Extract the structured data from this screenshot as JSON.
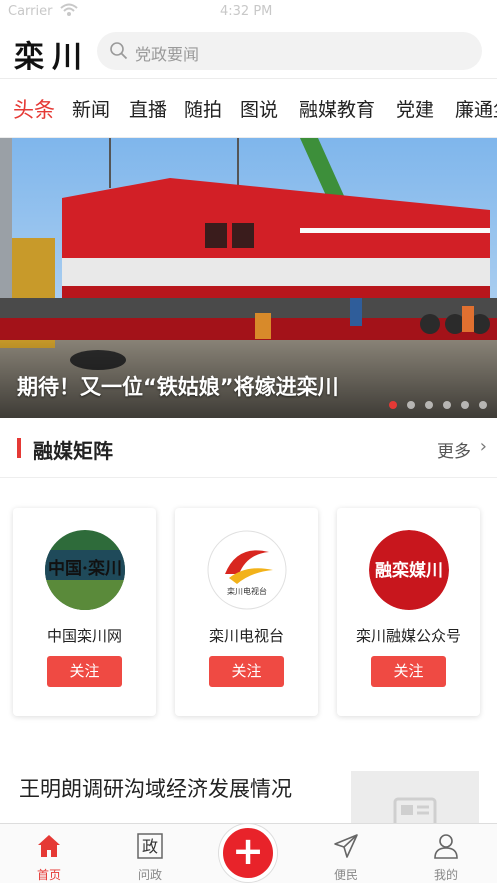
{
  "status_bar": {
    "carrier": "Carrier",
    "time": "4:32 PM"
  },
  "header": {
    "logo": "栾川",
    "search_placeholder": "党政要闻"
  },
  "tabs": [
    "头条",
    "新闻",
    "直播",
    "随拍",
    "图说",
    "融媒教育",
    "党建",
    "廉通尘"
  ],
  "active_tab": 0,
  "banner": {
    "caption": "期待！又一位“铁姑娘”将嫁进栾川",
    "dot_count": 6,
    "active_dot": 0
  },
  "matrix": {
    "title": "融媒矩阵",
    "more": "更多",
    "cards": [
      {
        "name": "中国栾川网",
        "follow": "关注",
        "logo_text": "中国·栾川"
      },
      {
        "name": "栾川电视台",
        "follow": "关注",
        "logo_text": "栾川电视台"
      },
      {
        "name": "栾川融媒公众号",
        "follow": "关注",
        "logo_text": "融栾媒川"
      }
    ]
  },
  "news": {
    "title": "王明朗调研沟域经济发展情况"
  },
  "tabbar": {
    "items": [
      {
        "label": "首页",
        "icon": "home-icon"
      },
      {
        "label": "问政",
        "icon": "politics-icon"
      },
      {
        "label": "",
        "icon": "plus-icon"
      },
      {
        "label": "便民",
        "icon": "send-icon"
      },
      {
        "label": "我的",
        "icon": "user-icon"
      }
    ],
    "politics_char": "政"
  },
  "colors": {
    "accent": "#e53935",
    "follow_bg": "#ef4a43",
    "fab": "#e8232a"
  }
}
